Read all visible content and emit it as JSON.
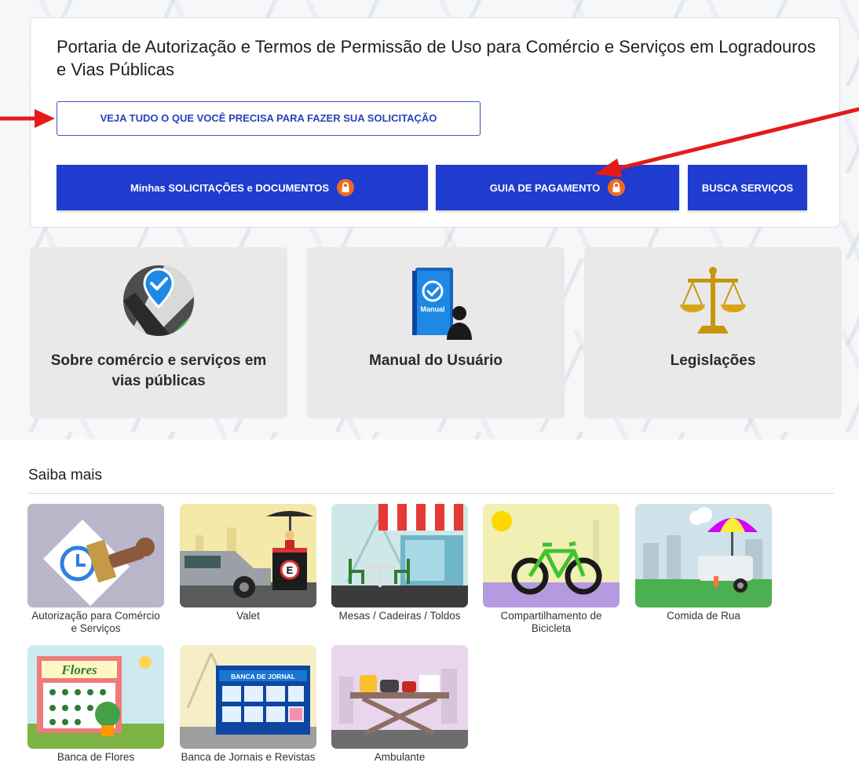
{
  "header": {
    "title": "Portaria de Autorização e Termos de Permissão de Uso para Comércio e Serviços em Logradouros e Vias Públicas",
    "requirements_button": "VEJA TUDO O QUE VOCÊ PRECISA PARA FAZER SUA SOLICITAÇÃO"
  },
  "actions": {
    "my_requests": "Minhas SOLICITAÇÕES e DOCUMENTOS",
    "payment_guide": "GUIA DE PAGAMENTO",
    "search_services": "BUSCA SERVIÇOS"
  },
  "tiles": [
    {
      "label": "Sobre comércio e serviços em vias públicas",
      "icon": "map-pin-check-icon"
    },
    {
      "label": "Manual do Usuário",
      "icon": "manual-book-user-icon",
      "badge": "Manual"
    },
    {
      "label": "Legislações",
      "icon": "scales-icon"
    }
  ],
  "saiba_mais": {
    "title": "Saiba mais",
    "items": [
      {
        "label": "Autorização para Comércio e Serviços"
      },
      {
        "label": "Valet"
      },
      {
        "label": "Mesas / Cadeiras / Toldos"
      },
      {
        "label": "Compartilhamento de Bicicleta"
      },
      {
        "label": "Comida de Rua"
      },
      {
        "label": "Banca de Flores",
        "sign": "Flores"
      },
      {
        "label": "Banca de Jornais e Revistas",
        "sign": "BANCA DE JORNAL"
      },
      {
        "label": "Ambulante"
      }
    ]
  },
  "colors": {
    "primary_button": "#1f3ccf",
    "lock_badge": "#f06a1e",
    "annotation_arrow": "#e31b1b",
    "tile_background": "#e9e9e9"
  }
}
